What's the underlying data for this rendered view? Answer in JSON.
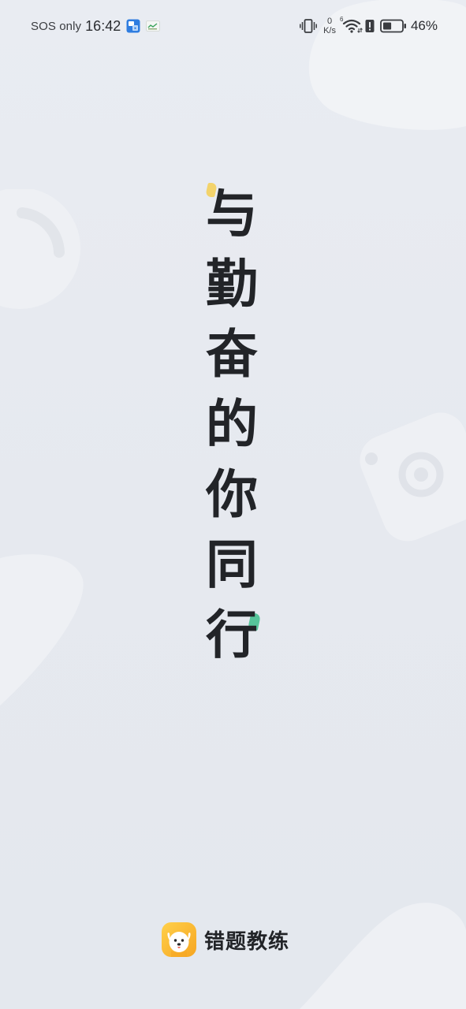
{
  "status_bar": {
    "carrier_text": "SOS only",
    "time": "16:42",
    "net_speed_value": "0",
    "net_speed_unit": "K/s",
    "wifi_badge": "6",
    "battery_percent": "46%",
    "battery_level": 0.46,
    "icons": {
      "notification_1": "translate-app-icon",
      "notification_2": "app-notification-icon",
      "vibrate": "vibrate-icon",
      "wifi": "wifi-icon",
      "alert": "alert-icon",
      "battery": "battery-icon"
    }
  },
  "splash": {
    "slogan_chars": [
      "与",
      "勤",
      "奋",
      "的",
      "你",
      "同",
      "行"
    ],
    "accent_colors": {
      "yellow": "#f3d36b",
      "green": "#56c49a"
    }
  },
  "brand": {
    "name": "错题教练",
    "logo_icon": "dog-mascot-icon",
    "logo_color": "#f6a521"
  },
  "colors": {
    "background": "#e7eaf0",
    "text": "#222428"
  }
}
